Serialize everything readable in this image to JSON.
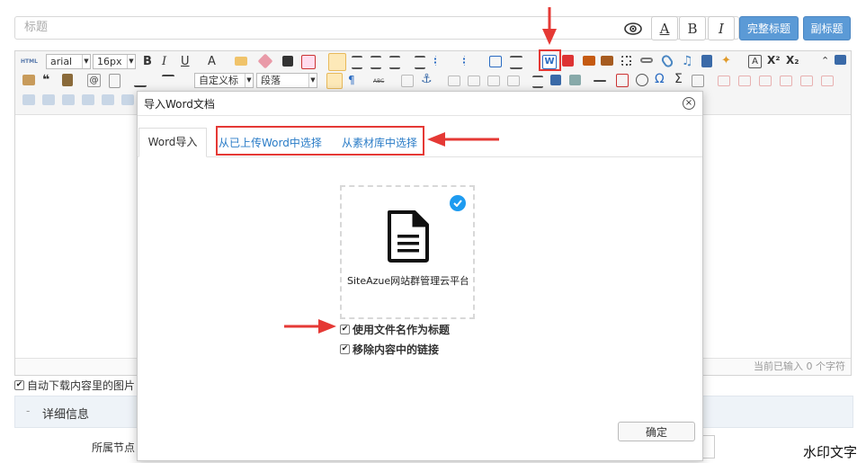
{
  "title_field": {
    "placeholder": "标题"
  },
  "format_buttons": {
    "a": "A",
    "b": "B",
    "i": "I"
  },
  "action_buttons": {
    "full_title": "完整标题",
    "sub_title": "副标题"
  },
  "toolbar": {
    "font_family": "arial",
    "font_size": "16px",
    "custom_title": "自定义标",
    "paragraph": "段落",
    "html_label": "HTML",
    "abc_label": "ABC"
  },
  "editor": {
    "status": "当前已输入 0 个字符"
  },
  "auto_download": {
    "label": "自动下载内容里的图片"
  },
  "details": {
    "label": "详细信息",
    "toggle": "-"
  },
  "node": {
    "label": "所属节点"
  },
  "watermark": "水印文字",
  "modal": {
    "title": "导入Word文档",
    "close": "×",
    "tabs": [
      {
        "label": "Word导入"
      },
      {
        "label": "从已上传Word中选择"
      },
      {
        "label": "从素材库中选择"
      }
    ],
    "file": {
      "name": "SiteAzue网站群管理云平台"
    },
    "options": [
      {
        "label": "使用文件名作为标题",
        "checked": true
      },
      {
        "label": "移除内容中的链接",
        "checked": true
      }
    ],
    "confirm": "确定"
  },
  "colors": {
    "accent_blue": "#5b9ad6",
    "highlight_red": "#e53935",
    "link_blue": "#2a7cc7"
  }
}
